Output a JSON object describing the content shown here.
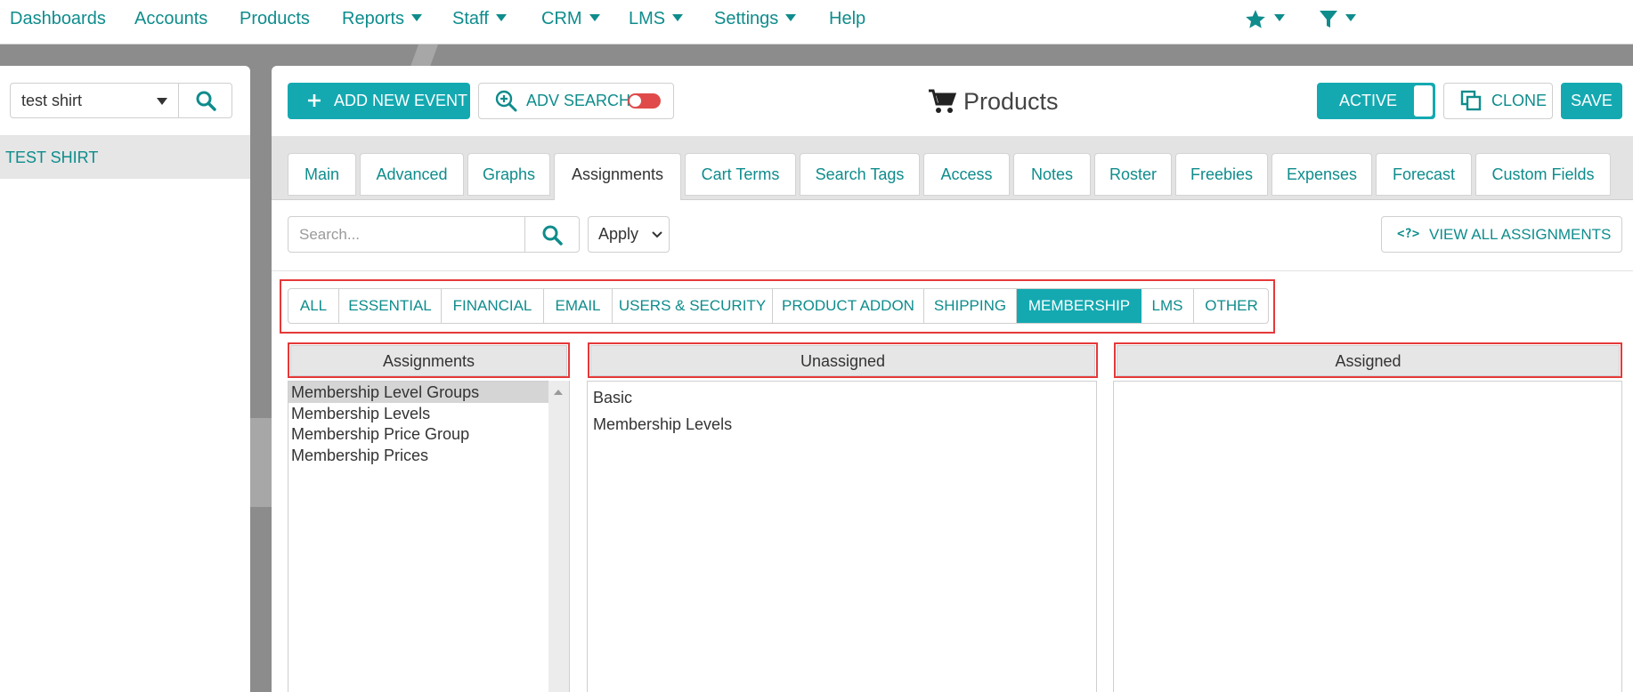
{
  "nav": {
    "items": [
      "Dashboards",
      "Accounts",
      "Products",
      "Reports",
      "Staff",
      "CRM",
      "LMS",
      "Settings",
      "Help"
    ],
    "star_icon": "star-icon",
    "filter_icon": "filter-icon"
  },
  "sidebar": {
    "search_value": "test shirt",
    "results": [
      "TEST SHIRT"
    ]
  },
  "toolbar": {
    "add_new_event": "ADD NEW EVENT",
    "adv_search": "ADV SEARCH",
    "page_title": "Products",
    "active_label": "ACTIVE",
    "clone_label": "CLONE",
    "save_label": "SAVE"
  },
  "tabs": [
    "Main",
    "Advanced",
    "Graphs",
    "Assignments",
    "Cart Terms",
    "Search Tags",
    "Access",
    "Notes",
    "Roster",
    "Freebies",
    "Expenses",
    "Forecast",
    "Custom Fields"
  ],
  "active_tab": "Assignments",
  "assignments": {
    "search_placeholder": "Search...",
    "apply_label": "Apply",
    "view_all_label": "VIEW ALL ASSIGNMENTS",
    "categories": [
      "ALL",
      "ESSENTIAL",
      "FINANCIAL",
      "EMAIL",
      "USERS & SECURITY",
      "PRODUCT ADDON",
      "SHIPPING",
      "MEMBERSHIP",
      "LMS",
      "OTHER"
    ],
    "active_category": "MEMBERSHIP",
    "columns": {
      "assignments_header": "Assignments",
      "unassigned_header": "Unassigned",
      "assigned_header": "Assigned"
    },
    "assignment_list": [
      "Membership Level Groups",
      "Membership Levels",
      "Membership Price Group",
      "Membership Prices"
    ],
    "selected_assignment": "Membership Level Groups",
    "unassigned_list": [
      "Basic",
      "Membership Levels"
    ],
    "assigned_list": []
  },
  "colors": {
    "accent": "#14a9b1",
    "link": "#0f8c8c",
    "highlight": "#e53939",
    "toggle_off": "#e04a4a"
  }
}
